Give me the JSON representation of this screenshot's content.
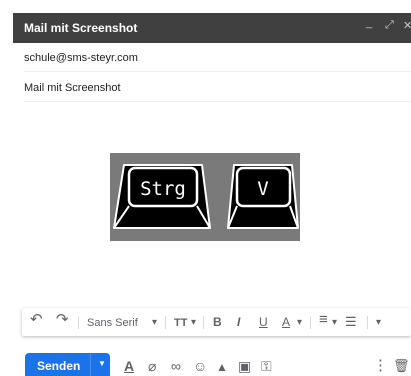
{
  "window": {
    "title": "Mail mit Screenshot",
    "minimize_glyph": "_",
    "maximize_glyph": "⤢",
    "close_glyph": "✕"
  },
  "compose": {
    "to_value": "schule@sms-steyr.com",
    "subject_value": "Mail mit Screenshot"
  },
  "body_image": {
    "keys": [
      "Strg",
      "V"
    ]
  },
  "format_toolbar": {
    "undo_glyph": "↶",
    "redo_glyph": "↷",
    "font_name": "Sans Serif",
    "dropdown_glyph": "▾",
    "text_size_glyph": "TT",
    "bold_glyph": "B",
    "italic_glyph": "I",
    "underline_glyph": "U",
    "text_color_glyph": "A",
    "align_glyph": "≡",
    "list_glyph": "☰",
    "more_glyph": "▾"
  },
  "bottom_toolbar": {
    "send_label": "Senden",
    "send_options_glyph": "▼",
    "format_glyph": "A",
    "attach_glyph": "⌀",
    "link_glyph": "∞",
    "emoji_glyph": "☺",
    "drive_glyph": "▲",
    "photo_glyph": "▣",
    "confidential_glyph": "⚿",
    "more_glyph": "⋮",
    "delete_glyph": "🗑"
  },
  "icons": {
    "titlebar": [
      "minimize-icon",
      "maximize-icon",
      "close-icon"
    ],
    "format": [
      "undo-icon",
      "redo-icon",
      "text-size-icon",
      "bold-icon",
      "italic-icon",
      "underline-icon",
      "text-color-icon",
      "align-icon",
      "list-icon",
      "more-formatting-icon"
    ],
    "bottom": [
      "format-options-icon",
      "attach-icon",
      "link-icon",
      "emoji-icon",
      "drive-icon",
      "photo-icon",
      "confidential-icon",
      "more-options-icon",
      "trash-icon"
    ]
  },
  "colors": {
    "titlebar_bg": "#404040",
    "send_button": "#1a73e8",
    "icon_gray": "#5f6368",
    "image_bg": "#7a7a7a"
  }
}
